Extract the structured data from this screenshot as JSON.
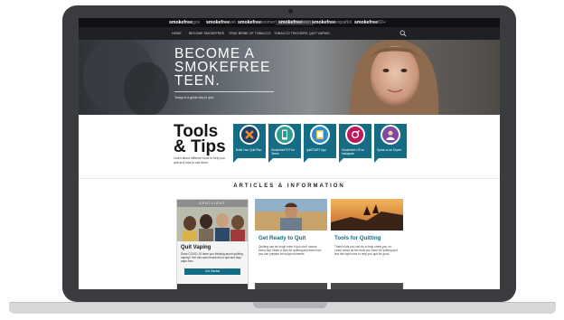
{
  "brand_bar": {
    "sites": [
      {
        "bold": "smokefree",
        "suffix": "gov"
      },
      {
        "bold": "smokefree",
        "suffix": "vet"
      },
      {
        "bold": "smokefree",
        "suffix": "women"
      },
      {
        "bold": "smokefree",
        "suffix": "teen"
      },
      {
        "bold": "smokefree",
        "suffix": "español"
      },
      {
        "bold": "smokefree",
        "suffix": "60+"
      }
    ],
    "active_index": 3
  },
  "nav": {
    "links": [
      "HOME",
      "BECOME SMOKEFREE",
      "TRUE BRINK OF TOBACCO",
      "TOBACCO TRIGGERS",
      "QUIT VAPING"
    ],
    "search_icon": "search-icon"
  },
  "hero": {
    "title": "BECOME A SMOKEFREE TEEN.",
    "subtitle": "Today is a great day to quit."
  },
  "tools": {
    "title_line1": "Tools",
    "title_line2": "& Tips",
    "description": "Learn about different tools to help you quit and how to use them.",
    "tiles": [
      {
        "label": "Build Your Quit Plan",
        "icon": "cross-icon",
        "color": "#1d3f66"
      },
      {
        "label": "SmokefreeTXT for Teens",
        "icon": "phone-icon",
        "color": "#2f9d92"
      },
      {
        "label": "quitSTART App",
        "icon": "tablet-icon",
        "color": "#2b8ecf"
      },
      {
        "label": "Smokefree US on Instagram",
        "icon": "instagram-icon",
        "color": "#c2185b"
      },
      {
        "label": "Speak to an Expert",
        "icon": "expert-avatar-icon",
        "color": "#7b4ba1"
      }
    ],
    "tile_color": "#146d84"
  },
  "articles": {
    "heading": "ARTICLES & INFORMATION",
    "spotlight": {
      "badge": "SPOTLIGHT",
      "title": "Quit Vaping",
      "text": "Does COVID-19 have you thinking about quitting vaping? Get info and resources to quit and stay vape-free.",
      "button": "Get Started"
    },
    "cards": [
      {
        "title": "Get Ready to Quit",
        "text": "Quitting can be tough even if you don't smoke every day. Make a plan for quitting and learn how you can prepare for tough moments."
      },
      {
        "title": "Tools for Quitting",
        "text": "There's lots you can do to help cheer you on. Learn about all the tools you have for quitting and find the right ones to help you quit for good."
      }
    ]
  },
  "colors": {
    "accent": "#146d84",
    "dark_bar": "#101012",
    "nav_bar": "#1f2023"
  }
}
